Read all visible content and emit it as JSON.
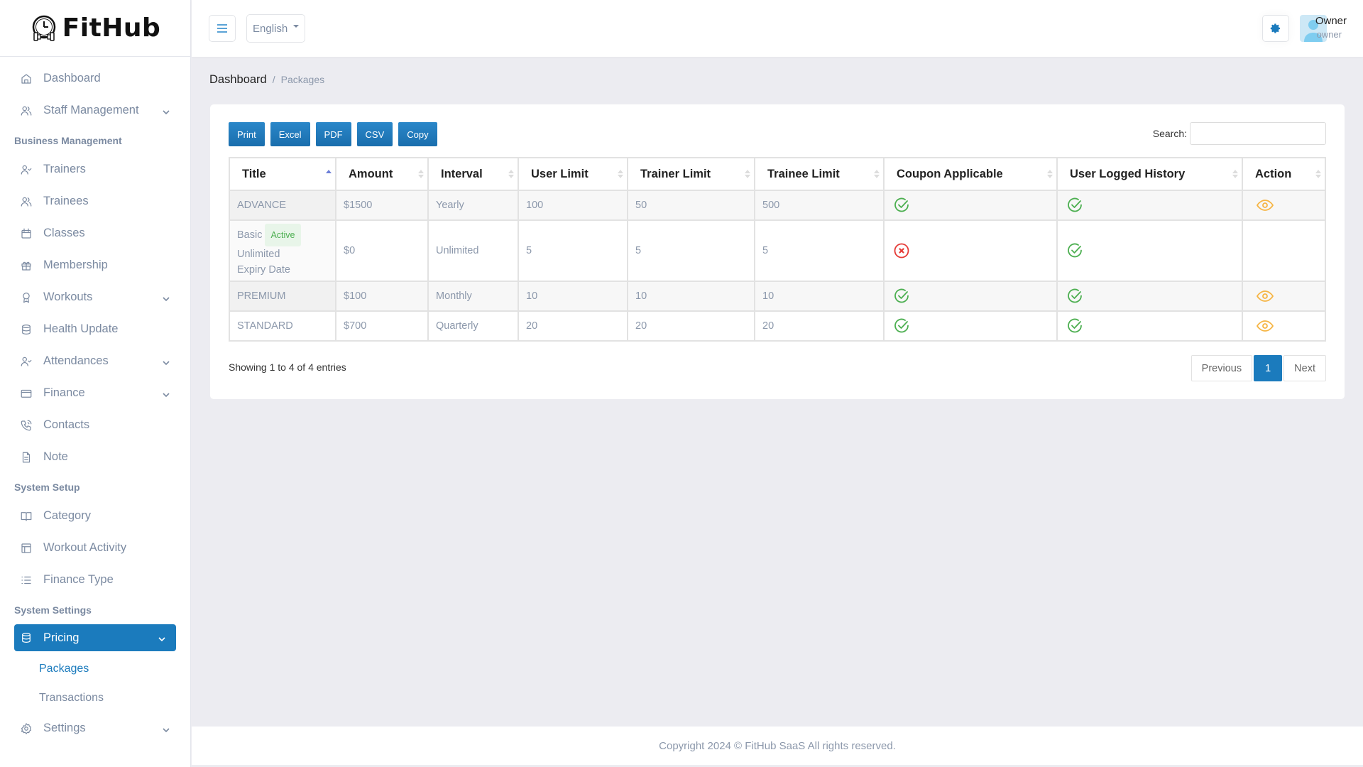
{
  "brand": {
    "name": "FitHub"
  },
  "sidebar": {
    "items": [
      {
        "label": "Dashboard",
        "icon": "home-icon",
        "chevron": false
      },
      {
        "label": "Staff Management",
        "icon": "users-icon",
        "chevron": true
      }
    ],
    "sections": [
      {
        "title": "Business Management",
        "items": [
          {
            "label": "Trainers",
            "icon": "user-check-icon",
            "chevron": false
          },
          {
            "label": "Trainees",
            "icon": "users-icon",
            "chevron": false
          },
          {
            "label": "Classes",
            "icon": "calendar-icon",
            "chevron": false
          },
          {
            "label": "Membership",
            "icon": "gift-icon",
            "chevron": false
          },
          {
            "label": "Workouts",
            "icon": "award-icon",
            "chevron": true
          },
          {
            "label": "Health Update",
            "icon": "database-icon",
            "chevron": false
          },
          {
            "label": "Attendances",
            "icon": "user-check-icon",
            "chevron": true
          },
          {
            "label": "Finance",
            "icon": "credit-card-icon",
            "chevron": true
          },
          {
            "label": "Contacts",
            "icon": "phone-call-icon",
            "chevron": false
          },
          {
            "label": "Note",
            "icon": "file-text-icon",
            "chevron": false
          }
        ]
      },
      {
        "title": "System Setup",
        "items": [
          {
            "label": "Category",
            "icon": "book-open-icon",
            "chevron": false
          },
          {
            "label": "Workout Activity",
            "icon": "layout-icon",
            "chevron": false
          },
          {
            "label": "Finance Type",
            "icon": "list-icon",
            "chevron": false
          }
        ]
      },
      {
        "title": "System Settings",
        "items": [
          {
            "label": "Pricing",
            "icon": "database-icon",
            "chevron": true,
            "active": true,
            "children": [
              {
                "label": "Packages",
                "current": true
              },
              {
                "label": "Transactions",
                "current": false
              }
            ]
          },
          {
            "label": "Settings",
            "icon": "settings-icon",
            "chevron": true
          }
        ]
      }
    ]
  },
  "header": {
    "language": "English",
    "user_name": "Owner",
    "user_role": "owner"
  },
  "breadcrumb": {
    "parent": "Dashboard",
    "separator": "/",
    "current": "Packages"
  },
  "toolbar": {
    "buttons": [
      "Print",
      "Excel",
      "PDF",
      "CSV",
      "Copy"
    ],
    "search_label": "Search:",
    "search_value": "",
    "search_placeholder": ""
  },
  "table": {
    "columns": [
      "Title",
      "Amount",
      "Interval",
      "User Limit",
      "Trainer Limit",
      "Trainee Limit",
      "Coupon Applicable",
      "User Logged History",
      "Action"
    ],
    "sorted_column": "Title",
    "sort_direction": "asc",
    "rows": [
      {
        "title": "ADVANCE",
        "badge": "",
        "extra": [],
        "amount": "$1500",
        "interval": "Yearly",
        "user_limit": "100",
        "trainer_limit": "50",
        "trainee_limit": "500",
        "coupon": true,
        "logged_history": true,
        "action": "view"
      },
      {
        "title": "Basic",
        "badge": "Active",
        "extra": [
          "Unlimited",
          "Expiry Date"
        ],
        "amount": "$0",
        "interval": "Unlimited",
        "user_limit": "5",
        "trainer_limit": "5",
        "trainee_limit": "5",
        "coupon": false,
        "logged_history": true,
        "action": ""
      },
      {
        "title": "PREMIUM",
        "badge": "",
        "extra": [],
        "amount": "$100",
        "interval": "Monthly",
        "user_limit": "10",
        "trainer_limit": "10",
        "trainee_limit": "10",
        "coupon": true,
        "logged_history": true,
        "action": "view"
      },
      {
        "title": "STANDARD",
        "badge": "",
        "extra": [],
        "amount": "$700",
        "interval": "Quarterly",
        "user_limit": "20",
        "trainer_limit": "20",
        "trainee_limit": "20",
        "coupon": true,
        "logged_history": true,
        "action": "view"
      }
    ]
  },
  "table_info": "Showing 1 to 4 of 4 entries",
  "pagination": {
    "previous": "Previous",
    "current": "1",
    "next": "Next"
  },
  "footer": {
    "text": "Copyright 2024 © FitHub SaaS All rights reserved."
  },
  "colors": {
    "primary": "#1b7bbd",
    "success": "#4caf50",
    "danger": "#e53935",
    "warning": "#f6b544",
    "muted": "#8c98ab"
  }
}
